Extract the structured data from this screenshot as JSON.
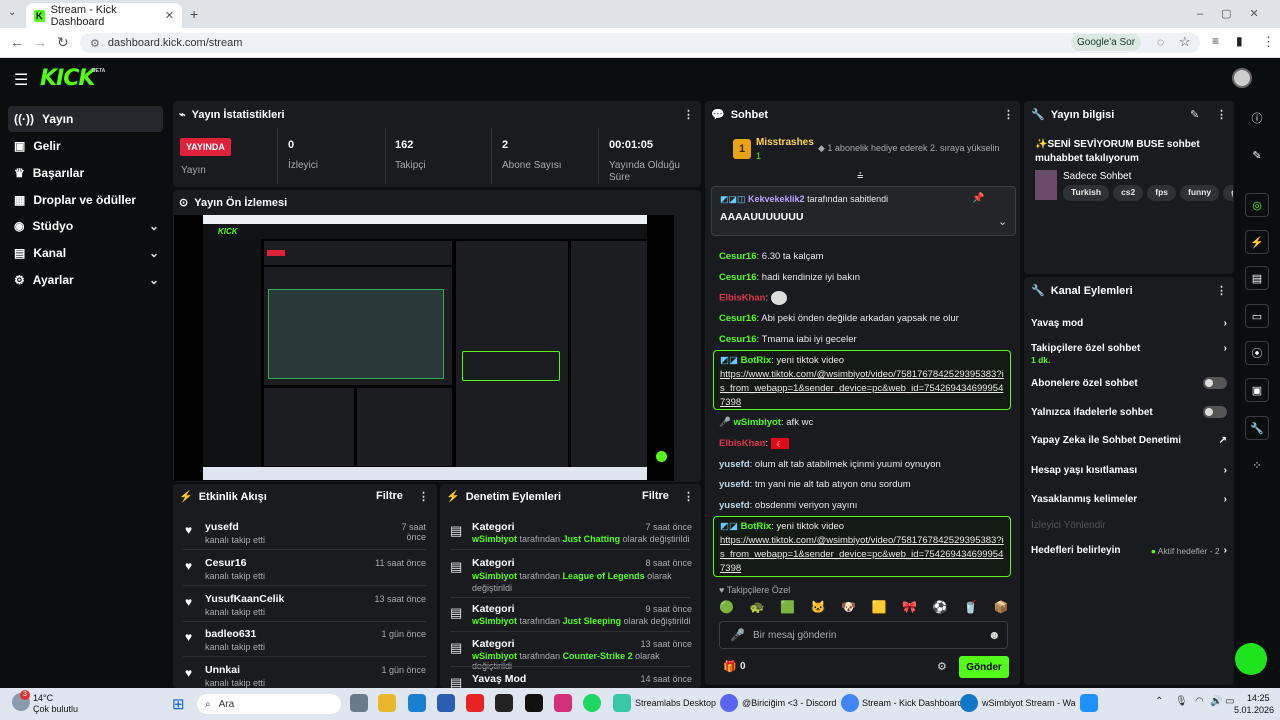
{
  "browser": {
    "tab_title": "Stream - Kick Dashboard",
    "url": "dashboard.kick.com/stream",
    "google_btn": "Google'a Sor"
  },
  "brand": {
    "logo": "KICK",
    "beta": "BETA"
  },
  "sidebar": {
    "items": [
      {
        "label": "Yayın",
        "icon": "broadcast-icon"
      },
      {
        "label": "Gelir",
        "icon": "revenue-icon"
      },
      {
        "label": "Başarılar",
        "icon": "trophy-icon"
      },
      {
        "label": "Droplar ve ödüller",
        "icon": "gift-icon"
      },
      {
        "label": "Stüdyo",
        "icon": "studio-icon"
      },
      {
        "label": "Kanal",
        "icon": "channel-icon"
      },
      {
        "label": "Ayarlar",
        "icon": "gear-icon"
      }
    ]
  },
  "stats": {
    "title": "Yayın İstatistikleri",
    "live_badge": "YAYINDA",
    "live_label": "Yayın",
    "items": [
      {
        "value": "0",
        "label": "İzleyici"
      },
      {
        "value": "162",
        "label": "Takipçi"
      },
      {
        "value": "2",
        "label": "Abone Sayısı"
      },
      {
        "value": "00:01:05",
        "label": "Yayında Olduğu Süre"
      }
    ]
  },
  "preview": {
    "title": "Yayın Ön İzlemesi"
  },
  "activity": {
    "title": "Etkinlik Akışı",
    "filter": "Filtre",
    "items": [
      {
        "name": "yusefd",
        "sub": "kanalı takip etti",
        "time": "7 saat önce"
      },
      {
        "name": "Cesur16",
        "sub": "kanalı takip etti",
        "time": "11 saat önce"
      },
      {
        "name": "YusufKaanCelik",
        "sub": "kanalı takip etti",
        "time": "13 saat önce"
      },
      {
        "name": "badleo631",
        "sub": "kanalı takip etti",
        "time": "1 gün önce"
      },
      {
        "name": "Unnkai",
        "sub": "kanalı takip etti",
        "time": "1 gün önce"
      }
    ]
  },
  "moderation": {
    "title": "Denetim Eylemleri",
    "filter": "Filtre",
    "items": [
      {
        "title": "Kategori",
        "user": "wSimbiyot",
        "mid": " tarafından ",
        "cat": "Just Chatting",
        "end": " olarak değiştirildi",
        "time": "7 saat önce"
      },
      {
        "title": "Kategori",
        "user": "wSimbiyot",
        "mid": " tarafından ",
        "cat": "League of Legends",
        "end": " olarak değiştirildi",
        "time": "8 saat önce"
      },
      {
        "title": "Kategori",
        "user": "wSimbiyot",
        "mid": " tarafından ",
        "cat": "Just Sleeping",
        "end": " olarak değiştirildi",
        "time": "9 saat önce"
      },
      {
        "title": "Kategori",
        "user": "wSimbiyot",
        "mid": " tarafından ",
        "cat": "Counter-Strike 2",
        "end": " olarak değiştirildi",
        "time": "13 saat önce"
      },
      {
        "title": "Yavaş Mod",
        "time": "14 saat önce"
      }
    ]
  },
  "chat": {
    "title": "Sohbet",
    "gifter": "Misstrashes",
    "gifter_count": "1",
    "gift_note": "1 abonelik hediye ederek 2. sıraya yükselin",
    "pinned_user": "Kekvekeklik2",
    "pinned_by": "tarafından sabitlendi",
    "pinned_msg": "AAAAUUUUUUU",
    "lines": [
      {
        "user": "Cesur16",
        "msg": "6.30 ta kalçam"
      },
      {
        "user": "Cesur16",
        "msg": "hadi kendinize iyi bakın"
      },
      {
        "user": "ElbisKhan",
        "msg": ""
      },
      {
        "user": "Cesur16",
        "msg": "Abi peki önden değilde arkadan yapsak ne olur"
      },
      {
        "user": "Cesur16",
        "msg": "Tmama iabi iyi geceler"
      }
    ],
    "bot1_user": "BotRix",
    "bot1_msg": "yeni tiktok video",
    "bot1_link": "https://www.tiktok.com/@wsimbiyot/video/7581767842529395383?is_from_webapp=1&sender_device=pc&web_id=7542694346999547398",
    "lines2": [
      {
        "user": "wSimbiyot",
        "msg": "afk wc"
      },
      {
        "user": "ElbisKhan",
        "msg": ""
      },
      {
        "user": "yusefd",
        "msg": "olum alt tab atabilmek içinmi yuumi oynuyon"
      },
      {
        "user": "yusefd",
        "msg": "tm yani nie alt tab atıyon onu sordum"
      },
      {
        "user": "yusefd",
        "msg": "obsdenmi veriyon yayını"
      }
    ],
    "bot2_user": "BotRix",
    "bot2_msg": "yeni tiktok video",
    "bot2_link": "https://www.tiktok.com/@wsimbiyot/video/7581767842529395383?is_from_webapp=1&sender_device=pc&web_id=7542694346999547398",
    "followers_only": "Takipçilere Özel",
    "input_placeholder": "Bir mesaj gönderin",
    "points": "0",
    "send": "Gönder"
  },
  "stream_info": {
    "title": "Yayın bilgisi",
    "stream_title": "✨SENİ SEVİYORUM BUSE sohbet muhabbet takılıyorum",
    "category": "Sadece Sohbet",
    "tags": [
      "Turkish",
      "cs2",
      "fps",
      "funny",
      "gam"
    ]
  },
  "channel_actions": {
    "title": "Kanal Eylemleri",
    "items": [
      {
        "label": "Yavaş mod",
        "type": "chev"
      },
      {
        "label": "Takipçilere özel sohbet",
        "sub": "1 dk.",
        "type": "chev"
      },
      {
        "label": "Abonelere özel sohbet",
        "type": "toggle"
      },
      {
        "label": "Yalnızca ifadelerle sohbet",
        "type": "toggle"
      },
      {
        "label": "Yapay Zeka ile Sohbet Denetimi",
        "type": "ext"
      },
      {
        "label": "Hesap yaşı kısıtlaması",
        "type": "chev"
      },
      {
        "label": "Yasaklanmış kelimeler",
        "type": "chev"
      },
      {
        "label": "İzleyici Yönlendir",
        "type": "disabled"
      },
      {
        "label": "Hedefleri belirleyin",
        "extra": "Aktif hedefler - 2",
        "type": "chev"
      }
    ]
  },
  "taskbar": {
    "weather_temp": "14°C",
    "weather_desc": "Çok bulutlu",
    "weather_badge": "3",
    "search": "Ara",
    "apps": [
      "Streamlabs Desktop",
      "@Biriciğim <3 - Discord",
      "Stream - Kick Dashboard",
      "wSimbiyot Stream - Wa"
    ],
    "time": "14:25",
    "date": "5.01.2026"
  },
  "colors": {
    "accent": "#53fc18",
    "panel": "#191b1f",
    "bg": "#0b0e0f",
    "live": "#e0213a"
  }
}
